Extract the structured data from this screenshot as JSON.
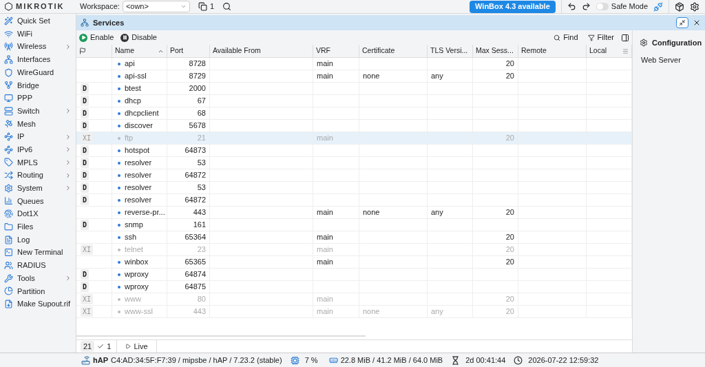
{
  "top_bar": {
    "brand": "MIKROTIK",
    "workspace_label": "Workspace:",
    "workspace_value": "<own>",
    "window_count": "1",
    "update_button": "WinBox 4.3 available",
    "safe_mode": {
      "label": "Safe Mode",
      "on": false
    }
  },
  "sidebar": {
    "items": [
      {
        "label": "Quick Set",
        "has_submenu": false
      },
      {
        "label": "WiFi",
        "has_submenu": false
      },
      {
        "label": "Wireless",
        "has_submenu": true
      },
      {
        "label": "Interfaces",
        "has_submenu": false
      },
      {
        "label": "WireGuard",
        "has_submenu": false
      },
      {
        "label": "Bridge",
        "has_submenu": false
      },
      {
        "label": "PPP",
        "has_submenu": false
      },
      {
        "label": "Switch",
        "has_submenu": true
      },
      {
        "label": "Mesh",
        "has_submenu": false
      },
      {
        "label": "IP",
        "has_submenu": true
      },
      {
        "label": "IPv6",
        "has_submenu": true
      },
      {
        "label": "MPLS",
        "has_submenu": true
      },
      {
        "label": "Routing",
        "has_submenu": true
      },
      {
        "label": "System",
        "has_submenu": true
      },
      {
        "label": "Queues",
        "has_submenu": false
      },
      {
        "label": "Dot1X",
        "has_submenu": false
      },
      {
        "label": "Files",
        "has_submenu": false
      },
      {
        "label": "Log",
        "has_submenu": false
      },
      {
        "label": "New Terminal",
        "has_submenu": false
      },
      {
        "label": "RADIUS",
        "has_submenu": false
      },
      {
        "label": "Tools",
        "has_submenu": true
      },
      {
        "label": "Partition",
        "has_submenu": false
      },
      {
        "label": "Make Supout.rif",
        "has_submenu": false
      }
    ]
  },
  "window": {
    "title": "Services",
    "toolbar": {
      "enable": "Enable",
      "disable": "Disable",
      "find": "Find",
      "filter": "Filter"
    }
  },
  "table": {
    "columns": [
      "Name",
      "Port",
      "Available From",
      "VRF",
      "Certificate",
      "TLS Versi...",
      "Max Sess...",
      "Remote",
      "Local"
    ],
    "rows": [
      {
        "flag": "",
        "name": "api",
        "port": "8728",
        "vrf": "main",
        "certificate": "",
        "tls": "",
        "max_sessions": "20",
        "disabled": false,
        "selected": false
      },
      {
        "flag": "",
        "name": "api-ssl",
        "port": "8729",
        "vrf": "main",
        "certificate": "none",
        "tls": "any",
        "max_sessions": "20",
        "disabled": false,
        "selected": false
      },
      {
        "flag": "D",
        "name": "btest",
        "port": "2000",
        "vrf": "",
        "certificate": "",
        "tls": "",
        "max_sessions": "",
        "disabled": false,
        "selected": false
      },
      {
        "flag": "D",
        "name": "dhcp",
        "port": "67",
        "vrf": "",
        "certificate": "",
        "tls": "",
        "max_sessions": "",
        "disabled": false,
        "selected": false
      },
      {
        "flag": "D",
        "name": "dhcpclient",
        "port": "68",
        "vrf": "",
        "certificate": "",
        "tls": "",
        "max_sessions": "",
        "disabled": false,
        "selected": false
      },
      {
        "flag": "D",
        "name": "discover",
        "port": "5678",
        "vrf": "",
        "certificate": "",
        "tls": "",
        "max_sessions": "",
        "disabled": false,
        "selected": false
      },
      {
        "flag": "XI",
        "name": "ftp",
        "port": "21",
        "vrf": "main",
        "certificate": "",
        "tls": "",
        "max_sessions": "20",
        "disabled": true,
        "selected": true
      },
      {
        "flag": "D",
        "name": "hotspot",
        "port": "64873",
        "vrf": "",
        "certificate": "",
        "tls": "",
        "max_sessions": "",
        "disabled": false,
        "selected": false
      },
      {
        "flag": "D",
        "name": "resolver",
        "port": "53",
        "vrf": "",
        "certificate": "",
        "tls": "",
        "max_sessions": "",
        "disabled": false,
        "selected": false
      },
      {
        "flag": "D",
        "name": "resolver",
        "port": "64872",
        "vrf": "",
        "certificate": "",
        "tls": "",
        "max_sessions": "",
        "disabled": false,
        "selected": false
      },
      {
        "flag": "D",
        "name": "resolver",
        "port": "53",
        "vrf": "",
        "certificate": "",
        "tls": "",
        "max_sessions": "",
        "disabled": false,
        "selected": false
      },
      {
        "flag": "D",
        "name": "resolver",
        "port": "64872",
        "vrf": "",
        "certificate": "",
        "tls": "",
        "max_sessions": "",
        "disabled": false,
        "selected": false
      },
      {
        "flag": "",
        "name": "reverse-pr...",
        "port": "443",
        "vrf": "main",
        "certificate": "none",
        "tls": "any",
        "max_sessions": "20",
        "disabled": false,
        "selected": false
      },
      {
        "flag": "D",
        "name": "snmp",
        "port": "161",
        "vrf": "",
        "certificate": "",
        "tls": "",
        "max_sessions": "",
        "disabled": false,
        "selected": false
      },
      {
        "flag": "",
        "name": "ssh",
        "port": "65364",
        "vrf": "main",
        "certificate": "",
        "tls": "",
        "max_sessions": "20",
        "disabled": false,
        "selected": false
      },
      {
        "flag": "XI",
        "name": "telnet",
        "port": "23",
        "vrf": "main",
        "certificate": "",
        "tls": "",
        "max_sessions": "20",
        "disabled": true,
        "selected": false
      },
      {
        "flag": "",
        "name": "winbox",
        "port": "65365",
        "vrf": "main",
        "certificate": "",
        "tls": "",
        "max_sessions": "20",
        "disabled": false,
        "selected": false
      },
      {
        "flag": "D",
        "name": "wproxy",
        "port": "64874",
        "vrf": "",
        "certificate": "",
        "tls": "",
        "max_sessions": "",
        "disabled": false,
        "selected": false
      },
      {
        "flag": "D",
        "name": "wproxy",
        "port": "64875",
        "vrf": "",
        "certificate": "",
        "tls": "",
        "max_sessions": "",
        "disabled": false,
        "selected": false
      },
      {
        "flag": "XI",
        "name": "www",
        "port": "80",
        "vrf": "main",
        "certificate": "",
        "tls": "",
        "max_sessions": "20",
        "disabled": true,
        "selected": false
      },
      {
        "flag": "XI",
        "name": "www-ssl",
        "port": "443",
        "vrf": "main",
        "certificate": "none",
        "tls": "any",
        "max_sessions": "20",
        "disabled": true,
        "selected": false
      }
    ]
  },
  "footer": {
    "count": "21",
    "selected_count": "1",
    "live": "Live"
  },
  "side_panel": {
    "title": "Configuration",
    "items": [
      "Web Server"
    ]
  },
  "status_bar": {
    "device": "hAP",
    "details": "C4:AD:34:5F:F7:39 / mipsbe / hAP / 7.23.2 (stable)",
    "cpu": "7 %",
    "memory": "22.8 MiB / 41.2 MiB / 64.0 MiB",
    "uptime": "2d 00:41:44",
    "clock": "2026-07-22 12:59:32"
  }
}
